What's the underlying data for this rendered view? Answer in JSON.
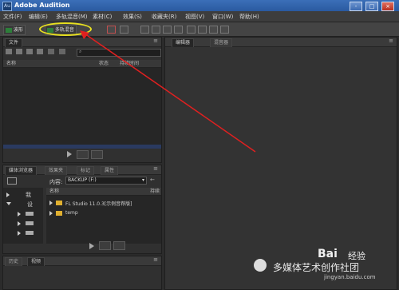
{
  "app": {
    "title": "Adobe Audition",
    "icon_text": "Au"
  },
  "window_controls": [
    "-",
    "□",
    "×"
  ],
  "menu": [
    "文件(F)",
    "编辑(E)",
    "多轨混音(M)",
    "素材(C)",
    "效果(S)",
    "收藏夹(R)",
    "视图(V)",
    "窗口(W)",
    "帮助(H)"
  ],
  "toolbar": {
    "waveform_label": "波形",
    "multitrack_label": "多轨混音"
  },
  "files_panel": {
    "tab": "文件",
    "columns": [
      "名称",
      "状态",
      "持续时间"
    ],
    "search_placeholder": ""
  },
  "media_panel": {
    "tabs": [
      "媒体浏览器",
      "效果夹",
      "标记",
      "属性"
    ],
    "location_label": "内容:",
    "location_value": "BACKUP (F:)",
    "tree_items": [
      "我",
      "设"
    ],
    "column": "名称",
    "column2": "持续",
    "files": [
      "FL Studio 11.0.3[示例音荐版]",
      "temp"
    ]
  },
  "editor_panel": {
    "tabs": [
      "编辑器",
      "混音器"
    ]
  },
  "history_panel": {
    "tabs": [
      "历史",
      "视频"
    ]
  },
  "watermark": {
    "text": "多媒体艺术创作社团",
    "brand": "Bai",
    "brand_suffix": "经验",
    "url": "jingyan.baidu.com"
  },
  "colors": {
    "highlight": "#e8e020",
    "arrow": "#e02020",
    "folder": "#e0b030"
  }
}
